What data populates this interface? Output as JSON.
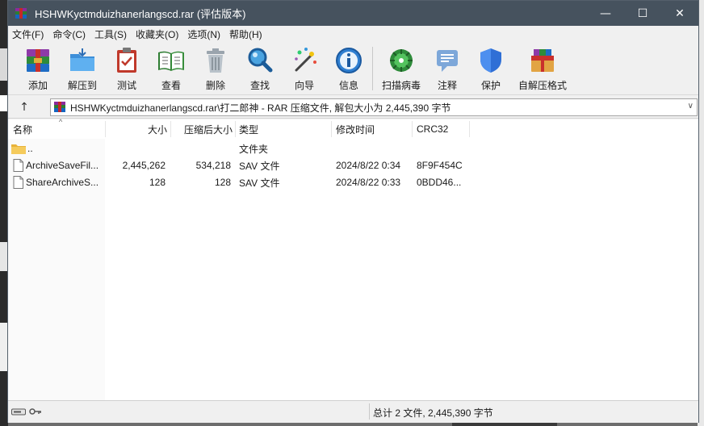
{
  "window": {
    "title": "HSHWKyctmduizhanerlangscd.rar (评估版本)",
    "controls": {
      "minimize": "—",
      "maximize": "☐",
      "close": "✕"
    }
  },
  "menu": [
    "文件(F)",
    "命令(C)",
    "工具(S)",
    "收藏夹(O)",
    "选项(N)",
    "帮助(H)"
  ],
  "toolbar": [
    {
      "label": "添加",
      "icon": "add-archive-icon"
    },
    {
      "label": "解压到",
      "icon": "extract-folder-icon"
    },
    {
      "label": "测试",
      "icon": "test-clipboard-icon"
    },
    {
      "label": "查看",
      "icon": "view-book-icon"
    },
    {
      "label": "删除",
      "icon": "trash-icon"
    },
    {
      "label": "查找",
      "icon": "magnifier-icon"
    },
    {
      "label": "向导",
      "icon": "wizard-wand-icon"
    },
    {
      "label": "信息",
      "icon": "info-icon"
    },
    {
      "label": "扫描病毒",
      "icon": "virus-scan-icon"
    },
    {
      "label": "注释",
      "icon": "comment-icon"
    },
    {
      "label": "保护",
      "icon": "shield-icon"
    },
    {
      "label": "自解压格式",
      "icon": "sfx-gift-icon"
    }
  ],
  "address": {
    "up": "↑",
    "path": "HSHWKyctmduizhanerlangscd.rar\\打二郎神 - RAR 压缩文件, 解包大小为 2,445,390 字节",
    "dropdown": "∨"
  },
  "columns": {
    "name": "名称",
    "size": "大小",
    "packed": "压缩后大小",
    "type": "类型",
    "modified": "修改时间",
    "crc": "CRC32"
  },
  "files": [
    {
      "name": "..",
      "size": "",
      "packed": "",
      "type": "文件夹",
      "modified": "",
      "crc": "",
      "icon": "folder-icon"
    },
    {
      "name": "ArchiveSaveFil...",
      "size": "2,445,262",
      "packed": "534,218",
      "type": "SAV 文件",
      "modified": "2024/8/22 0:34",
      "crc": "8F9F454C",
      "icon": "file-icon"
    },
    {
      "name": "ShareArchiveS...",
      "size": "128",
      "packed": "128",
      "type": "SAV 文件",
      "modified": "2024/8/22 0:33",
      "crc": "0BDD46...",
      "icon": "file-icon"
    }
  ],
  "status": {
    "summary": "总计 2 文件, 2,445,390 字节"
  }
}
